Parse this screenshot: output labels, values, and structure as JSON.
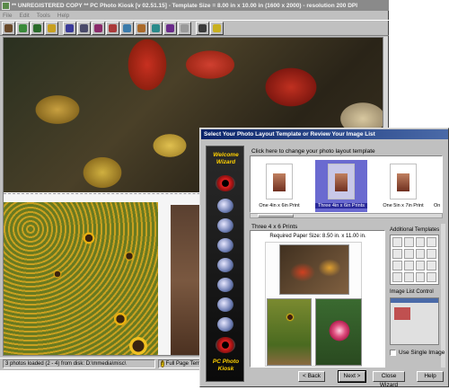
{
  "main_window": {
    "title": "** UNREGISTERED COPY ** PC Photo Kiosk [v 02.51.15] - Template Size = 8.00 in x 10.00 in (1600 x 2000) - resolution 200 DPI",
    "menu": [
      "File",
      "Edit",
      "Tools",
      "Help"
    ],
    "toolbar_icons": [
      {
        "name": "open-icon",
        "color": "#6a4a2a"
      },
      {
        "name": "scan-icon",
        "color": "#3a8a3a"
      },
      {
        "name": "import-icon",
        "color": "#2a6a2a"
      },
      {
        "name": "folder-icon",
        "color": "#c8a020"
      },
      {
        "name": "save-icon",
        "color": "#3a3a9a"
      },
      {
        "name": "print-icon",
        "color": "#4a4a6a"
      },
      {
        "name": "photo-icon",
        "color": "#8a2a6a"
      },
      {
        "name": "photo2-icon",
        "color": "#aa3a3a"
      },
      {
        "name": "crop-icon",
        "color": "#3a7aaa"
      },
      {
        "name": "rotate-icon",
        "color": "#aa6a2a"
      },
      {
        "name": "effects-icon",
        "color": "#2a8a8a"
      },
      {
        "name": "layout-icon",
        "color": "#6a2a8a"
      },
      {
        "name": "eraser-icon",
        "color": "#9a9a9a"
      },
      {
        "name": "pointer-icon",
        "color": "#3a3a3a"
      },
      {
        "name": "help-icon",
        "color": "#c8b020"
      }
    ],
    "status_left": "3 photos loaded (2 - 4) from disk: D:\\mmedia\\misc\\",
    "status_right": "Full Page Temp"
  },
  "wizard": {
    "title": "Select Your Photo Layout Template or Review Your Image List",
    "side_top": "Welcome Wizard",
    "side_bottom": "PC Photo Kiosk",
    "template_prompt": "Click here to change your photo layout template",
    "templates": [
      {
        "label": "One 4in x 6in Print",
        "selected": false
      },
      {
        "label": "Three 4in x 6in Prints",
        "selected": true
      },
      {
        "label": "One 5in x 7in Print",
        "selected": false
      },
      {
        "label": "On",
        "selected": false
      }
    ],
    "layout_title": "Three 4 x 6 Prints",
    "paper_size": "Required Paper Size: 8.50 in. x 11.00 in.",
    "additional_templates_label": "Additional Templates",
    "image_list_control_label": "Image List Control",
    "use_single_image_label": "Use Single Image",
    "use_single_image_checked": false,
    "buttons": {
      "back": "< Back",
      "next": "Next >",
      "close": "Close Wizard",
      "help": "Help"
    }
  }
}
